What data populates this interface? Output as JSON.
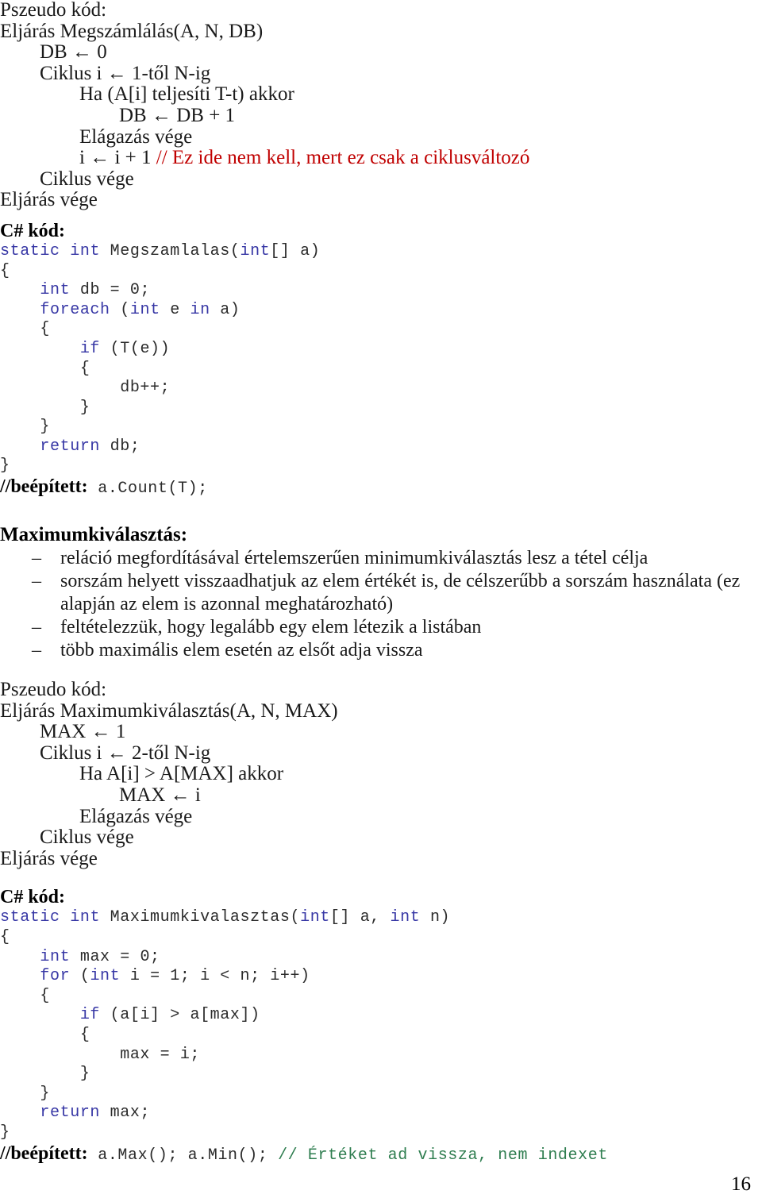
{
  "page": {
    "number": "16",
    "language": "hu"
  },
  "colors": {
    "keyword": "#3737A5",
    "comment_green": "#2E7D4F",
    "comment_red": "#C00000",
    "text": "#1a1a1a",
    "background": "#ffffff"
  },
  "sections": [
    {
      "id": "megszamlalas-pseudo",
      "label": "Pszeudo kód:",
      "lines": [
        {
          "indent": 0,
          "text": "Eljárás Megszámlálás(A, N, DB)"
        },
        {
          "indent": 1,
          "text": "DB ← 0"
        },
        {
          "indent": 1,
          "text": "Ciklus i ← 1-től N-ig"
        },
        {
          "indent": 2,
          "text": "Ha (A[i] teljesíti T-t) akkor"
        },
        {
          "indent": 3,
          "text": "DB ← DB + 1"
        },
        {
          "indent": 2,
          "text": "Elágazás vége"
        },
        {
          "indent": 2,
          "text": "i ← i + 1 ",
          "comment": "// Ez ide nem kell, mert ez csak a ciklusváltozó"
        },
        {
          "indent": 1,
          "text": "Ciklus vége"
        },
        {
          "indent": 0,
          "text": "Eljárás vége"
        }
      ]
    },
    {
      "id": "megszamlalas-csharp",
      "label": "C# kód:",
      "lines": [
        [
          {
            "t": "static",
            "c": "kw"
          },
          {
            "t": " ",
            "c": "plain"
          },
          {
            "t": "int",
            "c": "kw"
          },
          {
            "t": " Megszamlalas(",
            "c": "plain"
          },
          {
            "t": "int",
            "c": "kw"
          },
          {
            "t": "[] a)",
            "c": "plain"
          }
        ],
        [
          {
            "t": "{",
            "c": "plain"
          }
        ],
        [
          {
            "t": "    ",
            "c": "plain"
          },
          {
            "t": "int",
            "c": "kw"
          },
          {
            "t": " db = 0;",
            "c": "plain"
          }
        ],
        [
          {
            "t": "    ",
            "c": "plain"
          },
          {
            "t": "foreach",
            "c": "kw"
          },
          {
            "t": " (",
            "c": "plain"
          },
          {
            "t": "int",
            "c": "kw"
          },
          {
            "t": " e ",
            "c": "plain"
          },
          {
            "t": "in",
            "c": "kw"
          },
          {
            "t": " a)",
            "c": "plain"
          }
        ],
        [
          {
            "t": "    {",
            "c": "plain"
          }
        ],
        [
          {
            "t": "        ",
            "c": "plain"
          },
          {
            "t": "if",
            "c": "kw"
          },
          {
            "t": " (T(e))",
            "c": "plain"
          }
        ],
        [
          {
            "t": "        {",
            "c": "plain"
          }
        ],
        [
          {
            "t": "            db++;",
            "c": "plain"
          }
        ],
        [
          {
            "t": "        }",
            "c": "plain"
          }
        ],
        [
          {
            "t": "    }",
            "c": "plain"
          }
        ],
        [
          {
            "t": "    ",
            "c": "plain"
          },
          {
            "t": "return",
            "c": "kw"
          },
          {
            "t": " db;",
            "c": "plain"
          }
        ],
        [
          {
            "t": "}",
            "c": "plain"
          }
        ]
      ],
      "builtin": {
        "label": "//beépített:",
        "code": " a.Count(T);",
        "comment": ""
      }
    },
    {
      "id": "maximumkivalasztas-intro",
      "heading": "Maximumkiválasztás:",
      "bullet_mark": "–",
      "bullets": [
        {
          "text": "reláció megfordításával értelemszerűen minimumkiválasztás lesz a tétel célja",
          "cont": null
        },
        {
          "text": "sorszám helyett visszaadhatjuk az elem értékét is, de célszerűbb a sorszám használata (ez",
          "cont": "alapján az elem is azonnal meghatározható)"
        },
        {
          "text": "feltételezzük, hogy legalább egy elem létezik a listában",
          "cont": null
        },
        {
          "text": "több maximális elem esetén az elsőt adja vissza",
          "cont": null
        }
      ]
    },
    {
      "id": "maximumkivalasztas-pseudo",
      "label": "Pszeudo kód:",
      "lines": [
        {
          "indent": 0,
          "text": "Eljárás Maximumkiválasztás(A, N, MAX)"
        },
        {
          "indent": 1,
          "text": "MAX ← 1"
        },
        {
          "indent": 1,
          "text": "Ciklus i ← 2-től N-ig"
        },
        {
          "indent": 2,
          "text": "Ha A[i] > A[MAX] akkor"
        },
        {
          "indent": 3,
          "text": "MAX ← i"
        },
        {
          "indent": 2,
          "text": "Elágazás vége"
        },
        {
          "indent": 1,
          "text": "Ciklus vége"
        },
        {
          "indent": 0,
          "text": "Eljárás vége"
        }
      ]
    },
    {
      "id": "maximumkivalasztas-csharp",
      "label": "C# kód:",
      "lines": [
        [
          {
            "t": "static",
            "c": "kw"
          },
          {
            "t": " ",
            "c": "plain"
          },
          {
            "t": "int",
            "c": "kw"
          },
          {
            "t": " Maximumkivalasztas(",
            "c": "plain"
          },
          {
            "t": "int",
            "c": "kw"
          },
          {
            "t": "[] a, ",
            "c": "plain"
          },
          {
            "t": "int",
            "c": "kw"
          },
          {
            "t": " n)",
            "c": "plain"
          }
        ],
        [
          {
            "t": "{",
            "c": "plain"
          }
        ],
        [
          {
            "t": "    ",
            "c": "plain"
          },
          {
            "t": "int",
            "c": "kw"
          },
          {
            "t": " max = 0;",
            "c": "plain"
          }
        ],
        [
          {
            "t": "    ",
            "c": "plain"
          },
          {
            "t": "for",
            "c": "kw"
          },
          {
            "t": " (",
            "c": "plain"
          },
          {
            "t": "int",
            "c": "kw"
          },
          {
            "t": " i = 1; i < n; i++)",
            "c": "plain"
          }
        ],
        [
          {
            "t": "    {",
            "c": "plain"
          }
        ],
        [
          {
            "t": "        ",
            "c": "plain"
          },
          {
            "t": "if",
            "c": "kw"
          },
          {
            "t": " (a[i] > a[max])",
            "c": "plain"
          }
        ],
        [
          {
            "t": "        {",
            "c": "plain"
          }
        ],
        [
          {
            "t": "            max = i;",
            "c": "plain"
          }
        ],
        [
          {
            "t": "        }",
            "c": "plain"
          }
        ],
        [
          {
            "t": "    }",
            "c": "plain"
          }
        ],
        [
          {
            "t": "    ",
            "c": "plain"
          },
          {
            "t": "return",
            "c": "kw"
          },
          {
            "t": " max;",
            "c": "plain"
          }
        ],
        [
          {
            "t": "}",
            "c": "plain"
          }
        ]
      ],
      "builtin": {
        "label": "//beépített:",
        "code": " a.Max(); a.Min(); ",
        "comment": "// Értéket ad vissza, nem indexet"
      }
    }
  ]
}
